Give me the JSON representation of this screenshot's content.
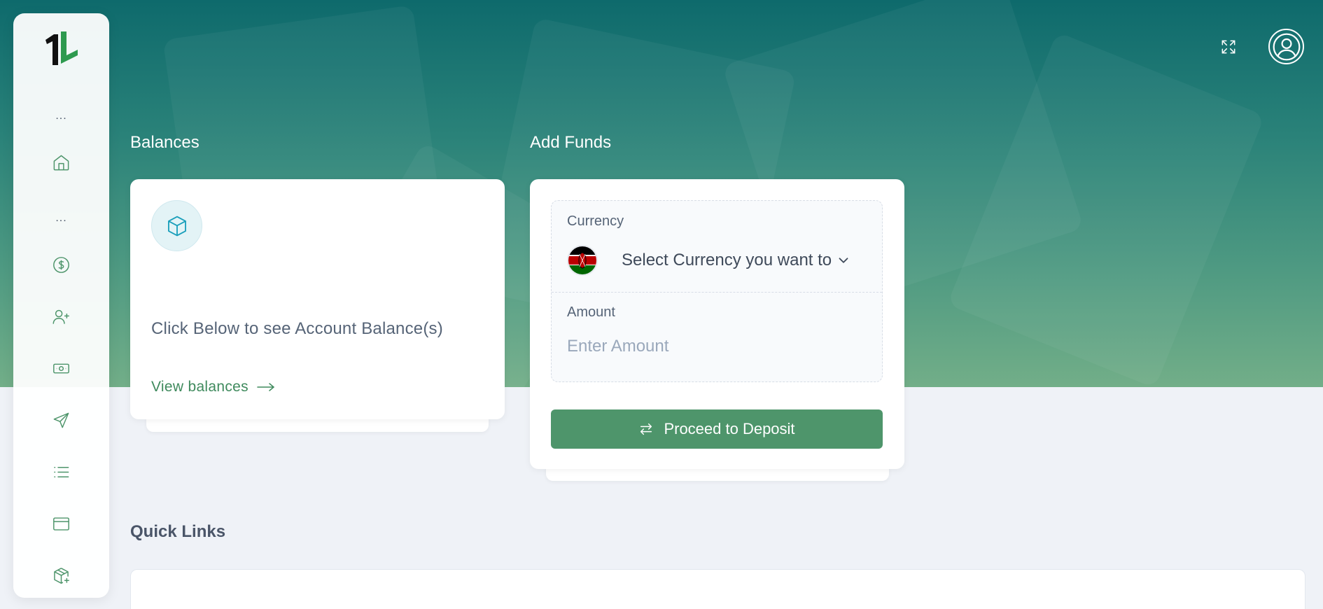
{
  "colors": {
    "brand_green": "#4e956b",
    "hero_top": "#0e6a6c",
    "hero_bottom": "#72ae88",
    "link_green": "#3f8a5d",
    "page_bg": "#eff2f7"
  },
  "sidebar": {
    "logo_text": "1L",
    "group_labels": [
      "...",
      "..."
    ],
    "items": [
      {
        "icon": "home-icon"
      },
      {
        "icon": "dollar-circle-icon"
      },
      {
        "icon": "user-plus-icon"
      },
      {
        "icon": "banknote-icon"
      },
      {
        "icon": "send-icon"
      },
      {
        "icon": "list-icon"
      },
      {
        "icon": "browser-window-icon"
      },
      {
        "icon": "package-plus-icon"
      }
    ]
  },
  "header": {
    "fullscreen_icon": "expand-icon",
    "profile_icon": "user-circle-icon"
  },
  "balances": {
    "title": "Balances",
    "icon": "cube-icon",
    "prompt": "Click Below to see Account Balance(s)",
    "link_label": "View balances",
    "link_icon": "arrow-right-icon"
  },
  "add_funds": {
    "title": "Add Funds",
    "currency_label": "Currency",
    "currency_flag": "kenya-flag-icon",
    "currency_placeholder": "Select Currency you want to deposit",
    "amount_label": "Amount",
    "amount_placeholder": "Enter Amount",
    "amount_value": "",
    "submit_label": "Proceed to Deposit",
    "submit_icon": "swap-arrows-icon"
  },
  "quick_links": {
    "title": "Quick Links"
  }
}
